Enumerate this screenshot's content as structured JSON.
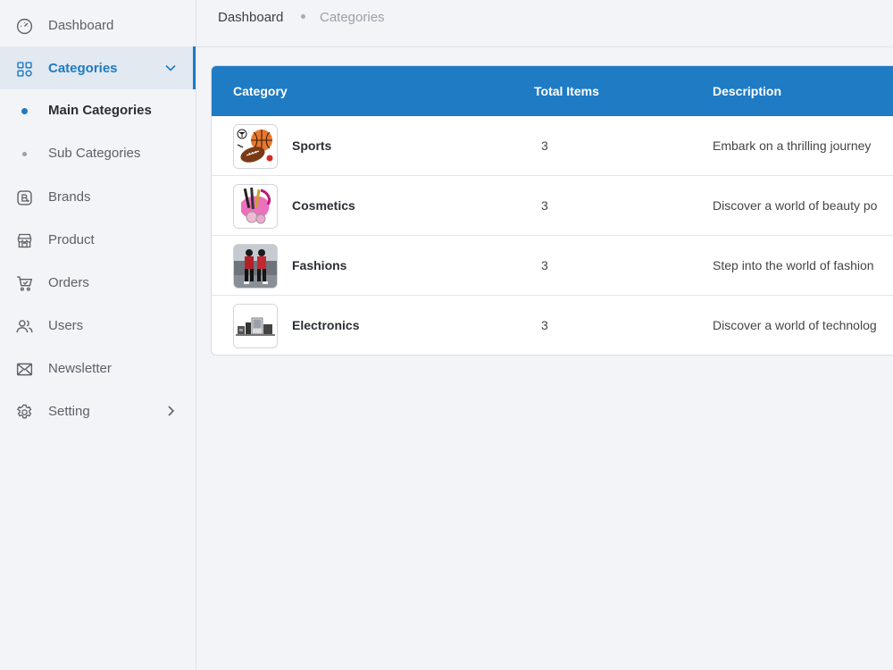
{
  "sidebar": {
    "items": [
      {
        "label": "Dashboard",
        "icon": "dashboard-icon"
      },
      {
        "label": "Categories",
        "icon": "grid-icon",
        "active": true
      },
      {
        "label": "Brands",
        "icon": "brand-icon"
      },
      {
        "label": "Product",
        "icon": "store-icon"
      },
      {
        "label": "Orders",
        "icon": "cart-icon"
      },
      {
        "label": "Users",
        "icon": "users-icon"
      },
      {
        "label": "Newsletter",
        "icon": "mail-icon"
      },
      {
        "label": "Setting",
        "icon": "gear-icon"
      }
    ],
    "sub_items": [
      {
        "label": "Main Categories",
        "active": true
      },
      {
        "label": "Sub Categories"
      }
    ]
  },
  "breadcrumb": {
    "home": "Dashboard",
    "current": "Categories"
  },
  "table": {
    "headers": [
      "Category",
      "Total Items",
      "Description"
    ],
    "rows": [
      {
        "name": "Sports",
        "total": "3",
        "description": "Embark on a thrilling journey",
        "thumb": "sports-image"
      },
      {
        "name": "Cosmetics",
        "total": "3",
        "description": "Discover a world of beauty po",
        "thumb": "cosmetics-image"
      },
      {
        "name": "Fashions",
        "total": "3",
        "description": "Step into the world of fashion",
        "thumb": "fashion-image"
      },
      {
        "name": "Electronics",
        "total": "3",
        "description": "Discover a world of technolog",
        "thumb": "electronics-image"
      }
    ]
  },
  "colors": {
    "accent": "#1e7bc4",
    "background": "#f3f4f8",
    "active_bg": "#e2e9f1"
  }
}
